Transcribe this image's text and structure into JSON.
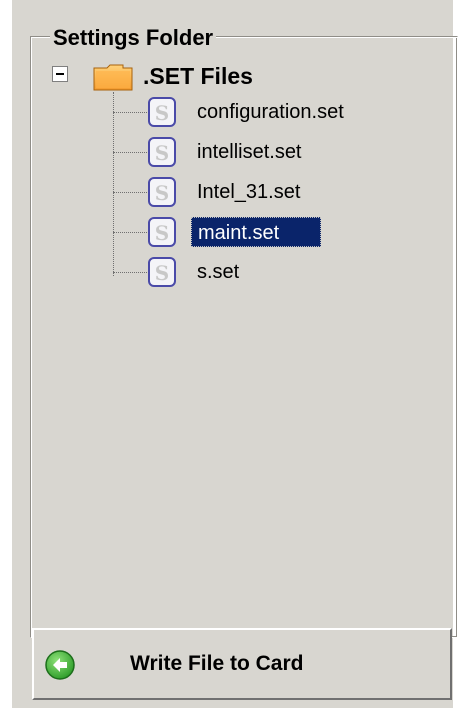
{
  "groupbox": {
    "title": "Settings Folder"
  },
  "tree": {
    "root": {
      "label": ".SET Files",
      "expanded": true,
      "icon": "folder-icon"
    },
    "items": [
      {
        "label": "configuration.set",
        "icon": "set-file-icon",
        "selected": false
      },
      {
        "label": "intelliset.set",
        "icon": "set-file-icon",
        "selected": false
      },
      {
        "label": "Intel_31.set",
        "icon": "set-file-icon",
        "selected": false
      },
      {
        "label": "maint.set",
        "icon": "set-file-icon",
        "selected": true
      },
      {
        "label": "s.set",
        "icon": "set-file-icon",
        "selected": false
      }
    ]
  },
  "actions": {
    "write_button_label": "Write File to Card",
    "write_icon": "green-arrow-left-icon"
  },
  "colors": {
    "selection": "#0a246a",
    "background": "#d8d6d0",
    "button_icon": "#2fa82a"
  }
}
